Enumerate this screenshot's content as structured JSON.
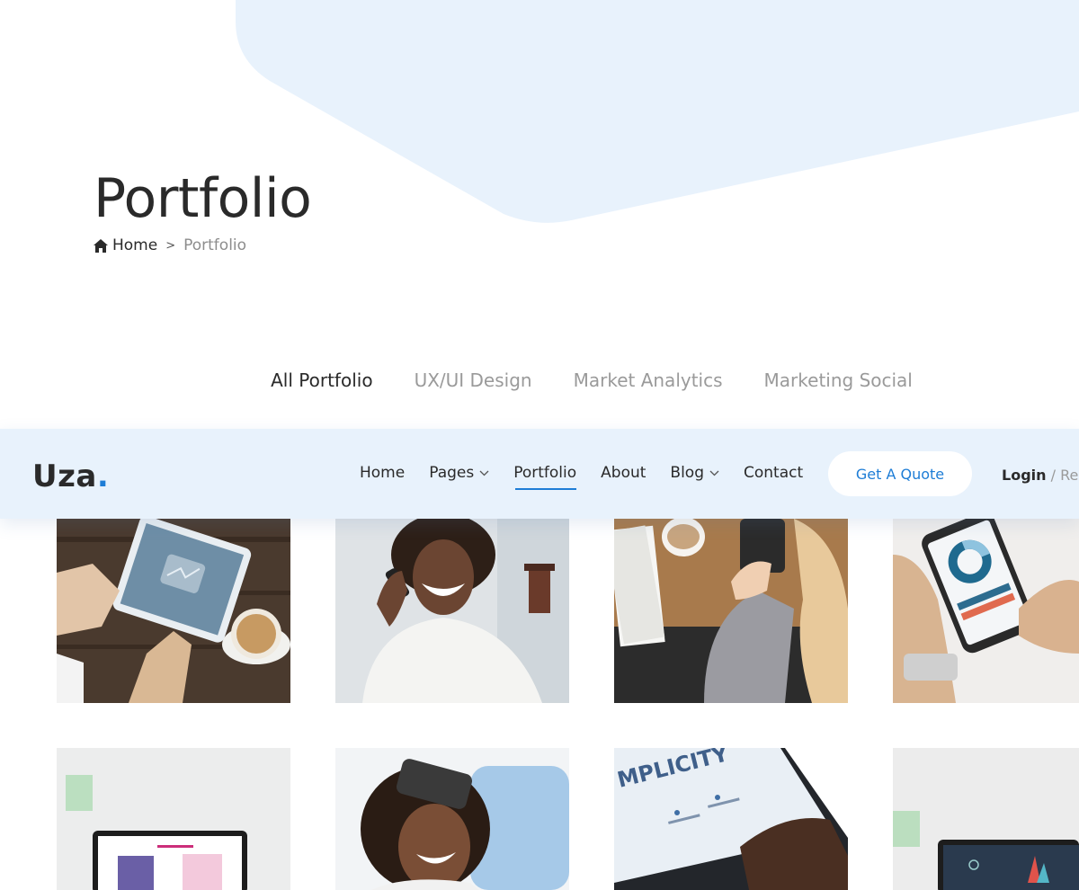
{
  "hero": {
    "title": "Portfolio",
    "breadcrumb": {
      "home_label": "Home",
      "separator": ">",
      "current": "Portfolio"
    }
  },
  "filters": [
    {
      "label": "All Portfolio",
      "active": true
    },
    {
      "label": "UX/UI Design",
      "active": false
    },
    {
      "label": "Market Analytics",
      "active": false
    },
    {
      "label": "Marketing Social",
      "active": false
    }
  ],
  "navbar": {
    "logo": "Uza",
    "logo_dot": ".",
    "items": [
      {
        "label": "Home"
      },
      {
        "label": "Pages",
        "dropdown": true
      },
      {
        "label": "Portfolio",
        "active": true
      },
      {
        "label": "About"
      },
      {
        "label": "Blog",
        "dropdown": true
      },
      {
        "label": "Contact"
      }
    ],
    "quote_button": "Get A Quote",
    "login": "Login",
    "slash": " / ",
    "register": "Regi"
  },
  "portfolio_images": [
    {
      "subject": "tablet-finance-coffee"
    },
    {
      "subject": "woman-phone-laughing"
    },
    {
      "subject": "phone-coffee-desk"
    },
    {
      "subject": "phone-analysis-app"
    },
    {
      "subject": "laptop-creative-site"
    },
    {
      "subject": "woman-vr-headset"
    },
    {
      "subject": "laptop-simplicity"
    },
    {
      "subject": "laptop-dashboard"
    }
  ],
  "colors": {
    "accent": "#1e7dd6",
    "hero_bg": "#e8f2fc",
    "text": "#2a2a2a",
    "muted": "#9a9a9a"
  }
}
